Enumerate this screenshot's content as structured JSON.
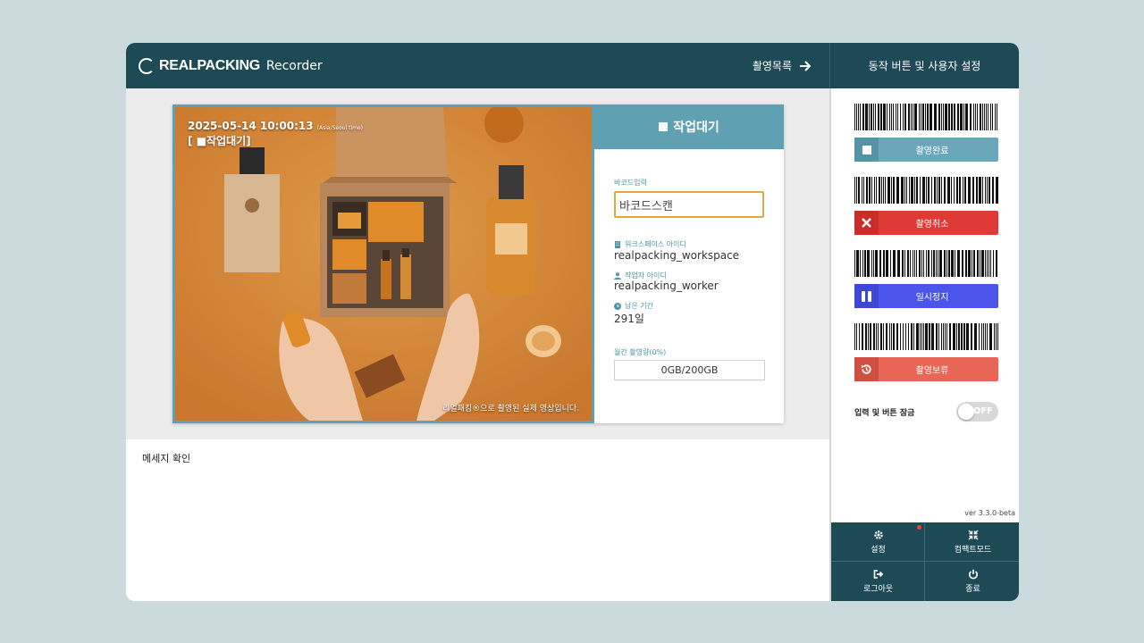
{
  "header": {
    "brand": "REALPACKING",
    "product": "Recorder",
    "list_link": "촬영목록",
    "right_title": "동작 버튼 및 사용자 설정"
  },
  "video": {
    "datetime": "2025-05-14 10:00:13",
    "timezone": "(Asia/Seoul time)",
    "state_tag": "[ ■작업대기]",
    "caption": "리얼패킹®으로 촬영된 실제 영상입니다."
  },
  "status": {
    "label": "작업대기",
    "color": "#5fa0b3"
  },
  "barcode": {
    "label": "바코드입력",
    "value": "바코드스캔"
  },
  "workspace": {
    "label": "워크스페이스 아이디",
    "value": "realpacking_workspace",
    "icon": "building-icon"
  },
  "worker": {
    "label": "작업자 아이디",
    "value": "realpacking_worker",
    "icon": "user-icon"
  },
  "remaining": {
    "label": "남은 기간",
    "value": "291일",
    "icon": "clock-icon"
  },
  "usage": {
    "label": "월간 촬영량(0%)",
    "value": "0GB/200GB",
    "percent": 0
  },
  "messages": {
    "title": "메세지 확인"
  },
  "actions": [
    {
      "label": "촬영완료",
      "icon": "stop-icon",
      "color": "#6aa8b9"
    },
    {
      "label": "촬영취소",
      "icon": "x-icon",
      "color": "#e03a36"
    },
    {
      "label": "일시정지",
      "icon": "pause-icon",
      "color": "#4b55ec"
    },
    {
      "label": "촬영보류",
      "icon": "history-icon",
      "color": "#e96657"
    }
  ],
  "lock": {
    "label": "입력 및 버튼 잠금",
    "state": "OFF"
  },
  "version": "ver 3.3.0-beta",
  "bottom_menu": [
    {
      "label": "설정",
      "icon": "gear-icon",
      "notification": true
    },
    {
      "label": "컴팩트모드",
      "icon": "compress-icon",
      "notification": false
    },
    {
      "label": "로그아웃",
      "icon": "logout-icon",
      "notification": false
    },
    {
      "label": "종료",
      "icon": "power-icon",
      "notification": false
    }
  ]
}
